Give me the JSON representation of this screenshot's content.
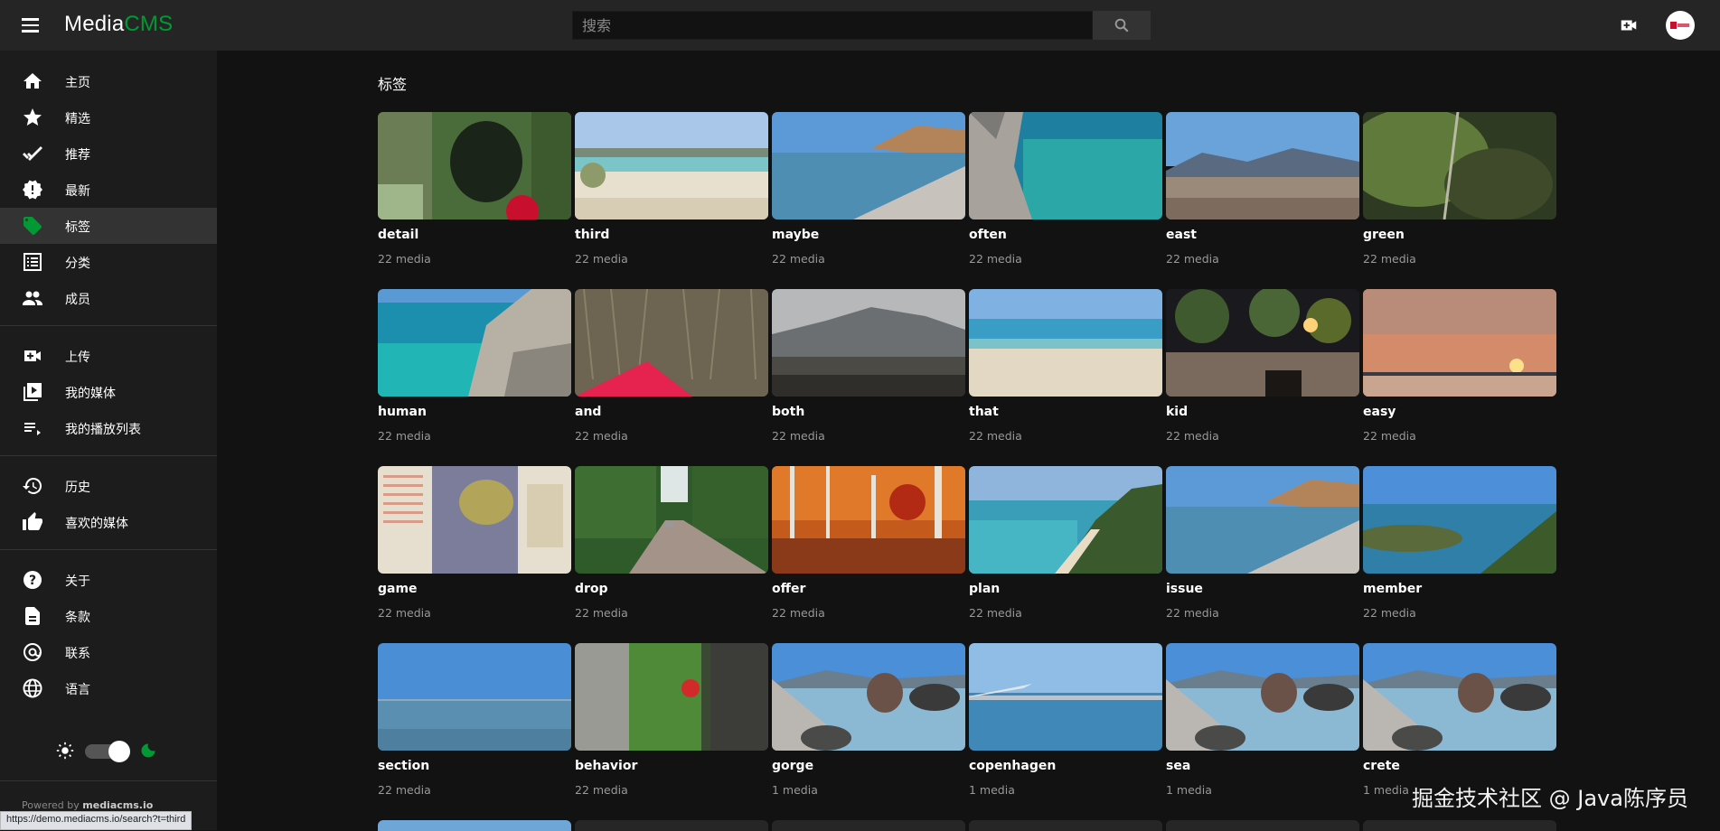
{
  "header": {
    "logo_part1": "Media",
    "logo_part2": "CMS",
    "search_placeholder": "搜索",
    "accent_color": "#009933"
  },
  "sidebar": {
    "items": [
      {
        "label": "主页",
        "icon": "home-icon"
      },
      {
        "label": "精选",
        "icon": "star-icon"
      },
      {
        "label": "推荐",
        "icon": "checkmark-icon"
      },
      {
        "label": "最新",
        "icon": "new-releases-icon"
      },
      {
        "label": "标签",
        "icon": "tag-icon",
        "active": true
      },
      {
        "label": "分类",
        "icon": "list-icon"
      },
      {
        "label": "成员",
        "icon": "people-icon"
      },
      {
        "label": "上传",
        "icon": "upload-video-icon"
      },
      {
        "label": "我的媒体",
        "icon": "my-media-icon"
      },
      {
        "label": "我的播放列表",
        "icon": "playlist-icon"
      },
      {
        "label": "历史",
        "icon": "history-icon"
      },
      {
        "label": "喜欢的媒体",
        "icon": "thumbs-up-icon"
      },
      {
        "label": "关于",
        "icon": "help-icon"
      },
      {
        "label": "条款",
        "icon": "document-icon"
      },
      {
        "label": "联系",
        "icon": "at-icon"
      },
      {
        "label": "语言",
        "icon": "globe-icon"
      }
    ],
    "powered_prefix": "Powered by",
    "powered_link": "mediacms.io"
  },
  "status_url": "https://demo.mediacms.io/search?t=third",
  "main": {
    "title": "标签",
    "tags": [
      {
        "name": "detail",
        "count": "22 media",
        "scene": "cave"
      },
      {
        "name": "third",
        "count": "22 media",
        "scene": "beach-dunes"
      },
      {
        "name": "maybe",
        "count": "22 media",
        "scene": "pebble-coast"
      },
      {
        "name": "often",
        "count": "22 media",
        "scene": "clear-sea"
      },
      {
        "name": "east",
        "count": "22 media",
        "scene": "mountain-rocks"
      },
      {
        "name": "green",
        "count": "22 media",
        "scene": "moss-rope"
      },
      {
        "name": "human",
        "count": "22 media",
        "scene": "rocky-cove"
      },
      {
        "name": "and",
        "count": "22 media",
        "scene": "reeds-kayak"
      },
      {
        "name": "both",
        "count": "22 media",
        "scene": "misty-mountain"
      },
      {
        "name": "that",
        "count": "22 media",
        "scene": "sandy-beach"
      },
      {
        "name": "kid",
        "count": "22 media",
        "scene": "night-square"
      },
      {
        "name": "easy",
        "count": "22 media",
        "scene": "sunset"
      },
      {
        "name": "game",
        "count": "22 media",
        "scene": "map"
      },
      {
        "name": "drop",
        "count": "22 media",
        "scene": "forest-road"
      },
      {
        "name": "offer",
        "count": "22 media",
        "scene": "autumn-forest"
      },
      {
        "name": "plan",
        "count": "22 media",
        "scene": "bay-aerial"
      },
      {
        "name": "issue",
        "count": "22 media",
        "scene": "pebble-coast"
      },
      {
        "name": "member",
        "count": "22 media",
        "scene": "lagoon"
      },
      {
        "name": "section",
        "count": "22 media",
        "scene": "calm-sea"
      },
      {
        "name": "behavior",
        "count": "22 media",
        "scene": "gorge-climber"
      },
      {
        "name": "gorge",
        "count": "1 media",
        "scene": "rocks-sea"
      },
      {
        "name": "copenhagen",
        "count": "1 media",
        "scene": "plane-wing"
      },
      {
        "name": "sea",
        "count": "1 media",
        "scene": "rocks-sea"
      },
      {
        "name": "crete",
        "count": "1 media",
        "scene": "rocks-sea"
      }
    ]
  },
  "watermark": "掘金技术社区 @ Java陈序员"
}
